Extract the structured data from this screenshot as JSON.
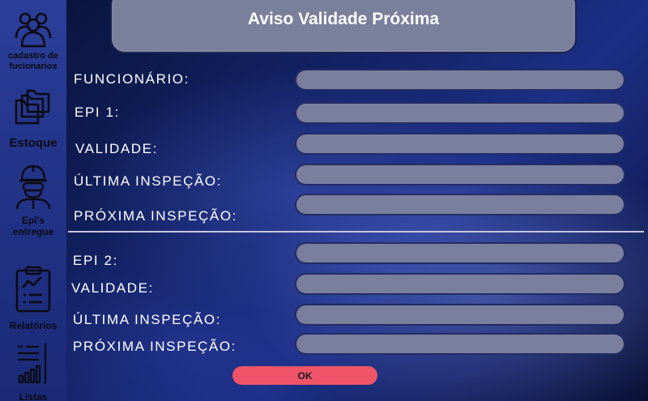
{
  "window": {
    "title": "Aviso Validade Próxima"
  },
  "sidebar": {
    "items": [
      {
        "label": "cadastro de fucionarios",
        "icon": "users-icon"
      },
      {
        "label": "Estoque",
        "icon": "folders-icon"
      },
      {
        "label": "Epi's entregue",
        "icon": "ppe-worker-icon"
      },
      {
        "label": "Relatórios",
        "icon": "clipboard-chart-icon"
      },
      {
        "label": "Listas",
        "icon": "list-chart-icon"
      }
    ]
  },
  "form": {
    "funcionario": {
      "label": "FUNCIONÁRIO:",
      "value": ""
    },
    "epi1": {
      "epi": {
        "label": "EPI 1:",
        "value": ""
      },
      "validade": {
        "label": "VALIDADE:",
        "value": ""
      },
      "ultima_inspecao": {
        "label": "ÚLTIMA INSPEÇÃO:",
        "value": ""
      },
      "proxima_inspecao": {
        "label": "PRÓXIMA INSPEÇÃO:",
        "value": ""
      }
    },
    "epi2": {
      "epi": {
        "label": "EPI 2:",
        "value": ""
      },
      "validade": {
        "label": "VALIDADE:",
        "value": ""
      },
      "ultima_inspecao": {
        "label": "ÚLTIMA INSPEÇÃO:",
        "value": ""
      },
      "proxima_inspecao": {
        "label": "PRÓXIMA INSPEÇÃO:",
        "value": ""
      }
    }
  },
  "actions": {
    "ok_label": "OK"
  },
  "colors": {
    "sidebar": "#2b3f9a",
    "header": "#7a7f9c",
    "field": "#7a7f9e",
    "ok_button": "#f05468"
  }
}
